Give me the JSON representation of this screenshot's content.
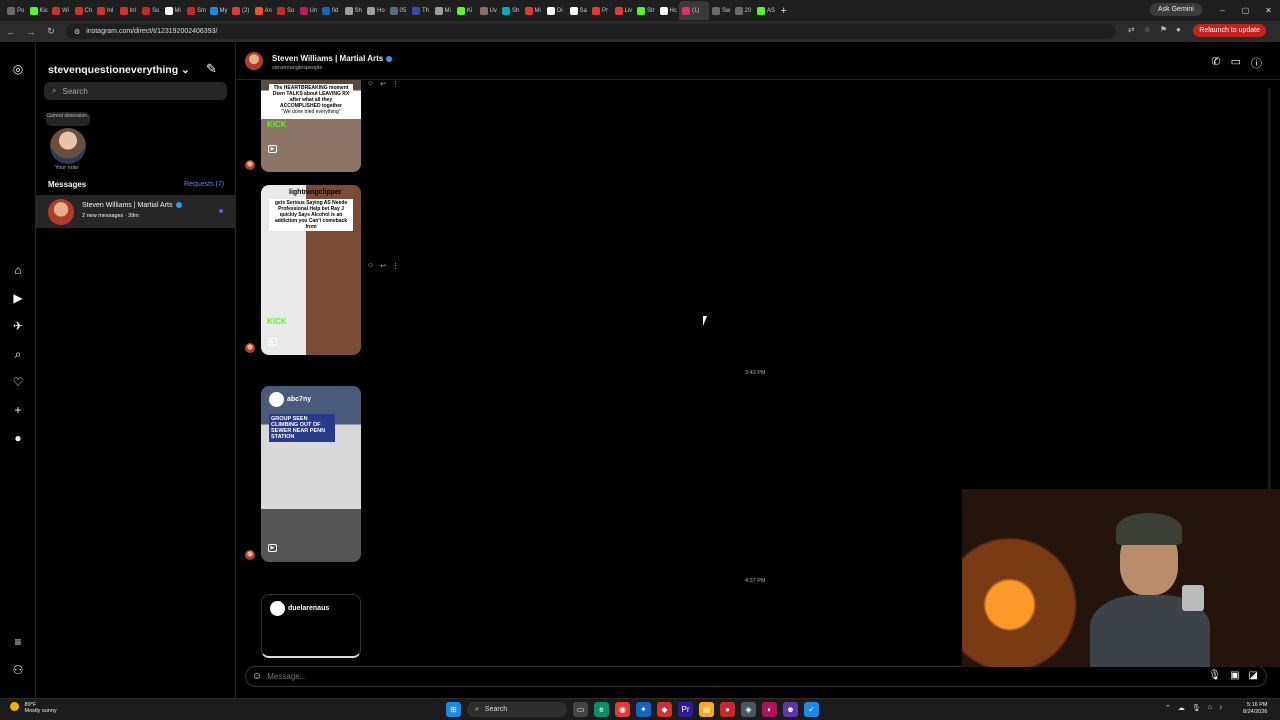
{
  "browser": {
    "tabs": [
      {
        "label": "Po",
        "color": "#6b6b6b"
      },
      {
        "label": "Kic",
        "color": "#53fc18"
      },
      {
        "label": "Wi",
        "color": "#c0392b"
      },
      {
        "label": "Ch",
        "color": "#d93025"
      },
      {
        "label": "Inl",
        "color": "#d93025"
      },
      {
        "label": "Inl",
        "color": "#d93025"
      },
      {
        "label": "So",
        "color": "#c62828"
      },
      {
        "label": "Mi",
        "color": "#ffffff"
      },
      {
        "label": "Sm",
        "color": "#c62828"
      },
      {
        "label": "My",
        "color": "#1e88e5"
      },
      {
        "label": "(2)",
        "color": "#e53935"
      },
      {
        "label": "An",
        "color": "#f4511e"
      },
      {
        "label": "So",
        "color": "#c62828"
      },
      {
        "label": "Un",
        "color": "#c2185b"
      },
      {
        "label": "fid",
        "color": "#1565c0"
      },
      {
        "label": "Sh",
        "color": "#9e9e9e"
      },
      {
        "label": "Ho",
        "color": "#9e9e9e"
      },
      {
        "label": "05",
        "color": "#546e7a"
      },
      {
        "label": "Th",
        "color": "#3949ab"
      },
      {
        "label": "Mi",
        "color": "#9e9e9e"
      },
      {
        "label": "Ki",
        "color": "#53fc18"
      },
      {
        "label": "Uv",
        "color": "#8d6e63"
      },
      {
        "label": "Sh",
        "color": "#00acc1"
      },
      {
        "label": "Mi",
        "color": "#e53935"
      },
      {
        "label": "Di",
        "color": "#ffffff"
      },
      {
        "label": "Sa",
        "color": "#ffffff"
      },
      {
        "label": "Pr",
        "color": "#e53935"
      },
      {
        "label": "Liv",
        "color": "#e53935"
      },
      {
        "label": "Str",
        "color": "#53fc18"
      },
      {
        "label": "Hc",
        "color": "#ffffff"
      },
      {
        "label": "(1)",
        "color": "#e1306c",
        "active": true
      },
      {
        "label": "Sw",
        "color": "#6b6b6b"
      },
      {
        "label": "20",
        "color": "#6b6b6b"
      },
      {
        "label": "AS",
        "color": "#53fc18"
      }
    ],
    "new_tab": "+",
    "ask_gemini": "Ask Gemini",
    "url": "instagram.com/direct/t/123192002406393/",
    "relaunch": "Relaunch to update",
    "win_min": "–",
    "win_max": "▢",
    "win_close": "✕"
  },
  "inbox": {
    "username": "stevenquestioneverything",
    "search_placeholder": "Search",
    "note_bubble": "Current obsession..",
    "note_label": "Your note",
    "messages_heading": "Messages",
    "requests": "Requests (7)",
    "conversation": {
      "name": "Steven Williams | Martial Arts",
      "subtitle": "2 new messages · 39m"
    }
  },
  "chat": {
    "name": "Steven Williams | Martial Arts",
    "handle": "steventanglespeople",
    "reel1_caption": "The HEARTBREAKING moment Deen TALKS about LEAVING RX after what all they ACCOMPLISHED together",
    "reel1_sub": "\"We done tried everything\"",
    "reel2_channel": "lightningclipper",
    "reel2_caption": "gets Serious Saying AS Needs Professional Help bet Ray J quickly Says Alcohol is an addiction you Can't comeback from",
    "kick_label": "KICK",
    "reel3_channel": "abc7ny",
    "reel3_caption": "GROUP SEEN CLIMBING OUT OF SEWER NEAR PENN STATION",
    "reel4_channel": "duelarenaus",
    "timestamp1": "3:43 PM",
    "timestamp2": "4:37 PM",
    "composer_placeholder": "Message..."
  },
  "taskbar": {
    "temp": "89°F",
    "weather": "Mostly sunny",
    "search": "Search",
    "time": "5:16 PM",
    "date": "8/24/2026"
  }
}
